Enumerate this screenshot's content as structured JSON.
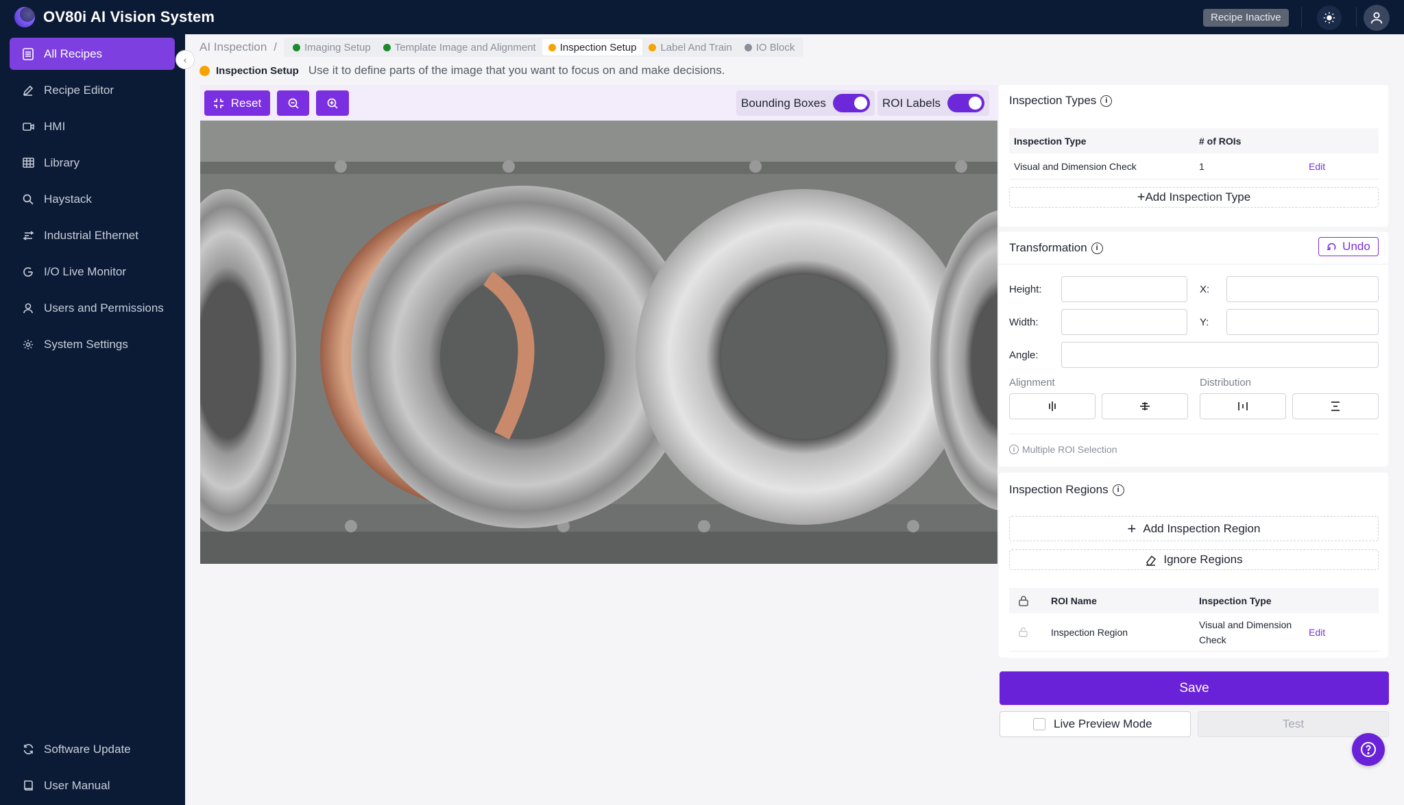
{
  "app": {
    "title": "OV80i AI Vision System",
    "recipe_status": "Recipe Inactive"
  },
  "sidebar": {
    "items": [
      {
        "label": "All Recipes",
        "icon": "document-list-icon",
        "active": true
      },
      {
        "label": "Recipe Editor",
        "icon": "pencil-icon"
      },
      {
        "label": "HMI",
        "icon": "video-icon"
      },
      {
        "label": "Library",
        "icon": "grid-icon"
      },
      {
        "label": "Haystack",
        "icon": "search-icon"
      },
      {
        "label": "Industrial Ethernet",
        "icon": "network-icon"
      },
      {
        "label": "I/O Live Monitor",
        "icon": "monitor-icon"
      },
      {
        "label": "Users and Permissions",
        "icon": "user-icon"
      },
      {
        "label": "System Settings",
        "icon": "gear-icon"
      }
    ],
    "bottom_items": [
      {
        "label": "Software Update",
        "icon": "refresh-icon"
      },
      {
        "label": "User Manual",
        "icon": "book-icon"
      }
    ]
  },
  "breadcrumb": {
    "root": "AI Inspection",
    "separator": "/",
    "steps": [
      {
        "label": "Imaging Setup",
        "status_color": "#1a8a2c"
      },
      {
        "label": "Template Image and Alignment",
        "status_color": "#1a8a2c"
      },
      {
        "label": "Inspection Setup",
        "status_color": "#f5a300",
        "active": true
      },
      {
        "label": "Label And Train",
        "status_color": "#f5a300"
      },
      {
        "label": "IO Block",
        "status_color": "#8a8f9a"
      }
    ]
  },
  "subheader": {
    "title": "Inspection Setup",
    "description": "Use it to define parts of the image that you want to focus on and make decisions.",
    "status_color": "#f5a300"
  },
  "toolbar": {
    "reset_label": "Reset",
    "bounding_boxes_label": "Bounding Boxes",
    "bounding_boxes_on": true,
    "roi_labels_label": "ROI Labels",
    "roi_labels_on": true
  },
  "inspection_types": {
    "title": "Inspection Types",
    "columns": [
      "Inspection Type",
      "# of ROIs"
    ],
    "rows": [
      {
        "type": "Visual and Dimension Check",
        "rois": "1",
        "action": "Edit"
      }
    ],
    "add_label": "Add Inspection Type"
  },
  "transformation": {
    "title": "Transformation",
    "undo_label": "Undo",
    "height_label": "Height:",
    "width_label": "Width:",
    "x_label": "X:",
    "y_label": "Y:",
    "angle_label": "Angle:",
    "alignment_label": "Alignment",
    "distribution_label": "Distribution",
    "hint": "Multiple ROI Selection"
  },
  "inspection_regions": {
    "title": "Inspection Regions",
    "add_label": "Add Inspection Region",
    "ignore_label": "Ignore Regions",
    "columns": [
      "ROI Name",
      "Inspection Type"
    ],
    "rows": [
      {
        "name": "Inspection Region",
        "type_line1": "Visual and Dimension",
        "type_line2": "Check",
        "action": "Edit"
      }
    ]
  },
  "actions": {
    "save_label": "Save",
    "live_preview_label": "Live Preview Mode",
    "test_label": "Test"
  },
  "colors": {
    "accent": "#6a22d9",
    "nav_bg": "#0b1a35",
    "active_nav": "#7e3fe0"
  }
}
